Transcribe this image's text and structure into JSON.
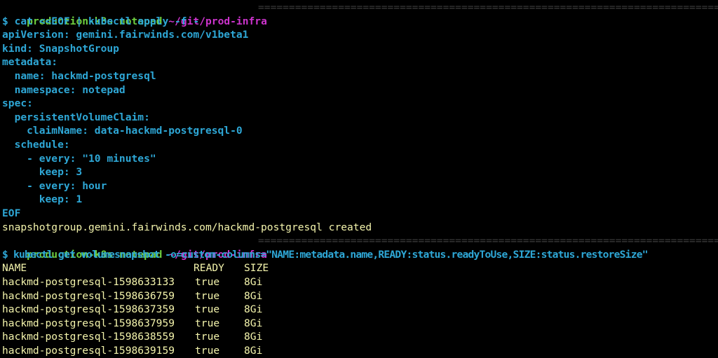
{
  "prompt": {
    "user_host": "production-k8s",
    "context": "notepad",
    "path": "~/git/prod-infra",
    "separator": "================================================================================="
  },
  "command1": "$ cat <<EOF | kubectl apply -f -",
  "heredoc": {
    "apiVersion": "apiVersion: gemini.fairwinds.com/v1beta1",
    "kind": "kind: SnapshotGroup",
    "metadata": "metadata:",
    "name": "  name: hackmd-postgresql",
    "namespace": "  namespace: notepad",
    "spec": "spec:",
    "pvc": "  persistentVolumeClaim:",
    "claimName": "    claimName: data-hackmd-postgresql-0",
    "schedule": "  schedule:",
    "every1": "    - every: \"10 minutes\"",
    "keep1": "      keep: 3",
    "every2": "    - every: hour",
    "keep2": "      keep: 1",
    "eof": "EOF"
  },
  "output1": "snapshotgroup.gemini.fairwinds.com/hackmd-postgresql created",
  "command2": "$ kubectl get volumesnapshot -o=custom-columns=\"NAME:metadata.name,READY:status.readyToUse,SIZE:status.restoreSize\"",
  "table": {
    "headers": [
      "NAME",
      "READY",
      "SIZE"
    ],
    "rows": [
      [
        "hackmd-postgresql-1598633133",
        "true",
        "8Gi"
      ],
      [
        "hackmd-postgresql-1598636759",
        "true",
        "8Gi"
      ],
      [
        "hackmd-postgresql-1598637359",
        "true",
        "8Gi"
      ],
      [
        "hackmd-postgresql-1598637959",
        "true",
        "8Gi"
      ],
      [
        "hackmd-postgresql-1598638559",
        "true",
        "8Gi"
      ],
      [
        "hackmd-postgresql-1598639159",
        "true",
        "8Gi"
      ]
    ]
  },
  "colors": {
    "background": "#000000",
    "prompt_green": "#6fcf3f",
    "path_magenta": "#cc33cc",
    "yaml_cyan": "#2ea7d6",
    "output_yellow": "#f4f4ac",
    "separator_gray": "#3f3f3f"
  }
}
